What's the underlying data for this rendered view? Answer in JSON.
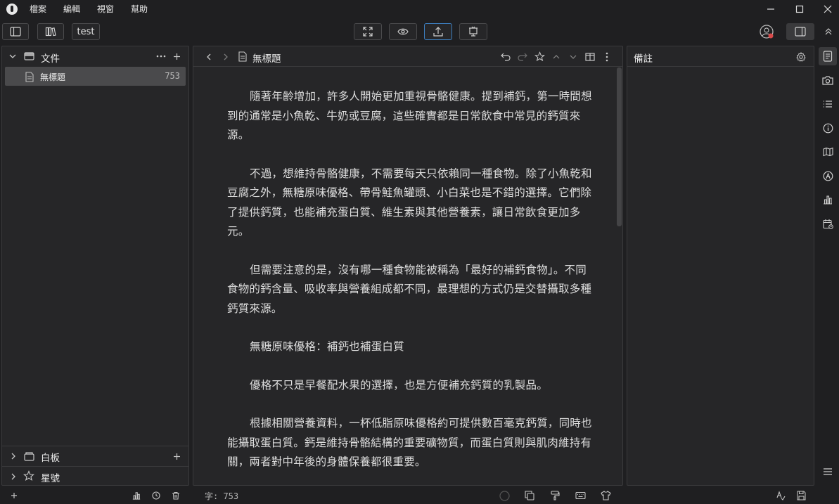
{
  "menu": [
    "檔案",
    "編輯",
    "視窗",
    "幫助"
  ],
  "toolbar": {
    "tab_label": "test"
  },
  "left_panel": {
    "section_title": "文件",
    "files": [
      {
        "name": "無標題",
        "count": "753"
      }
    ],
    "bottom_sections": [
      "白板",
      "星號"
    ]
  },
  "editor": {
    "doc_title": "無標題",
    "paragraphs": [
      "隨著年齡增加，許多人開始更加重視骨骼健康。提到補鈣，第一時間想到的通常是小魚乾、牛奶或豆腐，這些確實都是日常飲食中常見的鈣質來源。",
      "不過，想維持骨骼健康，不需要每天只依賴同一種食物。除了小魚乾和豆腐之外，無糖原味優格、帶骨鮭魚罐頭、小白菜也是不錯的選擇。它們除了提供鈣質，也能補充蛋白質、維生素與其他營養素，讓日常飲食更加多元。",
      "但需要注意的是，沒有哪一種食物能被稱為「最好的補鈣食物」。不同食物的鈣含量、吸收率與營養組成都不同，最理想的方式仍是交替攝取多種鈣質來源。",
      "無糖原味優格：補鈣也補蛋白質",
      "優格不只是早餐配水果的選擇，也是方便補充鈣質的乳製品。",
      "根據相關營養資料，一杯低脂原味優格約可提供數百毫克鈣質，同時也能攝取蛋白質。鈣是維持骨骼結構的重要礦物質，而蛋白質則與肌肉維持有關，兩者對中年後的身體保養都很重要。"
    ]
  },
  "right_panel": {
    "title": "備註"
  },
  "statusbar": {
    "word_count": "字: 753"
  },
  "colors": {
    "accent": "#3d7fc0",
    "background": "#1f1f21",
    "panel": "#262628",
    "selected_row": "#4a4a4c"
  }
}
